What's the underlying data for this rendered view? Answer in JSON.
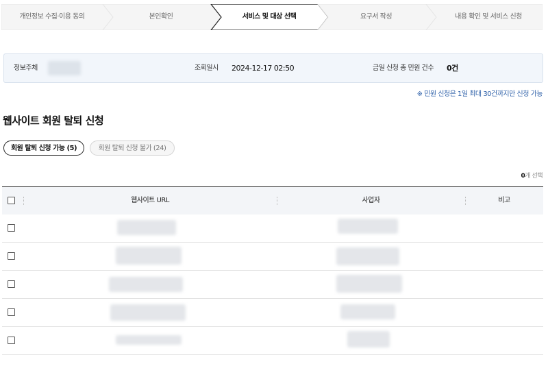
{
  "stepper": {
    "steps": [
      {
        "label": "개인정보 수집·이용 동의",
        "active": false
      },
      {
        "label": "본인확인",
        "active": false
      },
      {
        "label": "서비스 및 대상 선택",
        "active": true
      },
      {
        "label": "요구서 작성",
        "active": false
      },
      {
        "label": "내용 확인 및 서비스 신청",
        "active": false
      }
    ]
  },
  "info": {
    "subject_label": "정보주체",
    "query_label": "조회일시",
    "query_value": "2024-12-17 02:50",
    "today_label": "금일 신청 총 민원 건수",
    "today_value": "0건"
  },
  "notice": "※ 민원 신청은 1일 최대 30건까지만 신청 가능",
  "section_title": "웹사이트 회원 탈퇴 신청",
  "tabs": {
    "available": "회원 탈퇴 신청 가능 (5)",
    "unavailable": "회원 탈퇴 신청 불가 (24)"
  },
  "selection_count": {
    "number": "0",
    "suffix": "개 선택"
  },
  "table": {
    "headers": {
      "url": "웹사이트 URL",
      "company": "사업자",
      "note": "비고"
    },
    "rows": [
      {
        "url": "",
        "company": "",
        "note": ""
      },
      {
        "url": "",
        "company": "",
        "note": ""
      },
      {
        "url": "",
        "company": "",
        "note": ""
      },
      {
        "url": "",
        "company": "",
        "note": ""
      },
      {
        "url": "",
        "company": "",
        "note": ""
      }
    ]
  }
}
